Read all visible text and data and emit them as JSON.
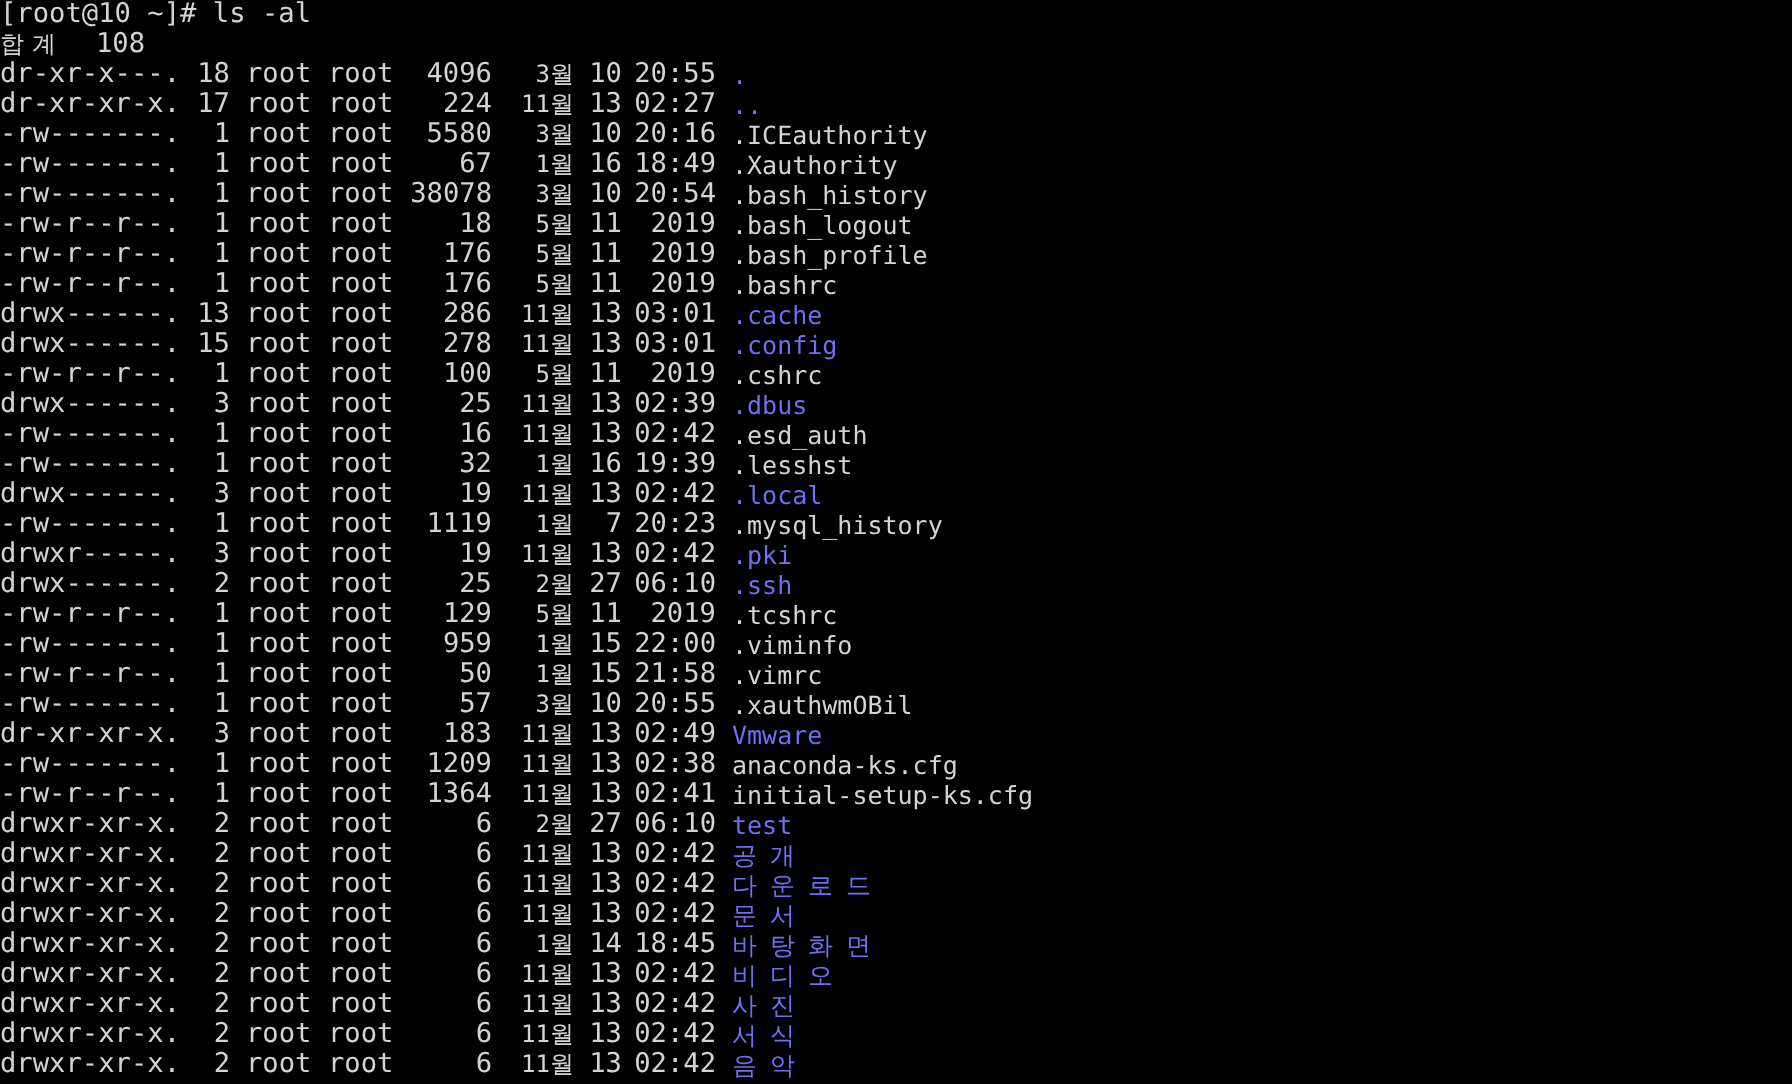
{
  "terminal": {
    "prompt": "[root@10 ~]# ls -al",
    "total_label": "합계",
    "total_value": "108",
    "entries": [
      {
        "perms": "dr-xr-x---.",
        "links": "18",
        "owner": "root",
        "group": "root",
        "size": "4096",
        "month": "3월",
        "day": "10",
        "time": "20:55",
        "name": ".",
        "kind": "dir"
      },
      {
        "perms": "dr-xr-xr-x.",
        "links": "17",
        "owner": "root",
        "group": "root",
        "size": "224",
        "month": "11월",
        "day": "13",
        "time": "02:27",
        "name": "..",
        "kind": "dir"
      },
      {
        "perms": "-rw-------.",
        "links": "1",
        "owner": "root",
        "group": "root",
        "size": "5580",
        "month": "3월",
        "day": "10",
        "time": "20:16",
        "name": ".ICEauthority",
        "kind": "file"
      },
      {
        "perms": "-rw-------.",
        "links": "1",
        "owner": "root",
        "group": "root",
        "size": "67",
        "month": "1월",
        "day": "16",
        "time": "18:49",
        "name": ".Xauthority",
        "kind": "file"
      },
      {
        "perms": "-rw-------.",
        "links": "1",
        "owner": "root",
        "group": "root",
        "size": "38078",
        "month": "3월",
        "day": "10",
        "time": "20:54",
        "name": ".bash_history",
        "kind": "file"
      },
      {
        "perms": "-rw-r--r--.",
        "links": "1",
        "owner": "root",
        "group": "root",
        "size": "18",
        "month": "5월",
        "day": "11",
        "time": "2019",
        "name": ".bash_logout",
        "kind": "file"
      },
      {
        "perms": "-rw-r--r--.",
        "links": "1",
        "owner": "root",
        "group": "root",
        "size": "176",
        "month": "5월",
        "day": "11",
        "time": "2019",
        "name": ".bash_profile",
        "kind": "file"
      },
      {
        "perms": "-rw-r--r--.",
        "links": "1",
        "owner": "root",
        "group": "root",
        "size": "176",
        "month": "5월",
        "day": "11",
        "time": "2019",
        "name": ".bashrc",
        "kind": "file"
      },
      {
        "perms": "drwx------.",
        "links": "13",
        "owner": "root",
        "group": "root",
        "size": "286",
        "month": "11월",
        "day": "13",
        "time": "03:01",
        "name": ".cache",
        "kind": "dir"
      },
      {
        "perms": "drwx------.",
        "links": "15",
        "owner": "root",
        "group": "root",
        "size": "278",
        "month": "11월",
        "day": "13",
        "time": "03:01",
        "name": ".config",
        "kind": "dir"
      },
      {
        "perms": "-rw-r--r--.",
        "links": "1",
        "owner": "root",
        "group": "root",
        "size": "100",
        "month": "5월",
        "day": "11",
        "time": "2019",
        "name": ".cshrc",
        "kind": "file"
      },
      {
        "perms": "drwx------.",
        "links": "3",
        "owner": "root",
        "group": "root",
        "size": "25",
        "month": "11월",
        "day": "13",
        "time": "02:39",
        "name": ".dbus",
        "kind": "dir"
      },
      {
        "perms": "-rw-------.",
        "links": "1",
        "owner": "root",
        "group": "root",
        "size": "16",
        "month": "11월",
        "day": "13",
        "time": "02:42",
        "name": ".esd_auth",
        "kind": "file"
      },
      {
        "perms": "-rw-------.",
        "links": "1",
        "owner": "root",
        "group": "root",
        "size": "32",
        "month": "1월",
        "day": "16",
        "time": "19:39",
        "name": ".lesshst",
        "kind": "file"
      },
      {
        "perms": "drwx------.",
        "links": "3",
        "owner": "root",
        "group": "root",
        "size": "19",
        "month": "11월",
        "day": "13",
        "time": "02:42",
        "name": ".local",
        "kind": "dir"
      },
      {
        "perms": "-rw-------.",
        "links": "1",
        "owner": "root",
        "group": "root",
        "size": "1119",
        "month": "1월",
        "day": "7",
        "time": "20:23",
        "name": ".mysql_history",
        "kind": "file"
      },
      {
        "perms": "drwxr-----.",
        "links": "3",
        "owner": "root",
        "group": "root",
        "size": "19",
        "month": "11월",
        "day": "13",
        "time": "02:42",
        "name": ".pki",
        "kind": "dir"
      },
      {
        "perms": "drwx------.",
        "links": "2",
        "owner": "root",
        "group": "root",
        "size": "25",
        "month": "2월",
        "day": "27",
        "time": "06:10",
        "name": ".ssh",
        "kind": "dir"
      },
      {
        "perms": "-rw-r--r--.",
        "links": "1",
        "owner": "root",
        "group": "root",
        "size": "129",
        "month": "5월",
        "day": "11",
        "time": "2019",
        "name": ".tcshrc",
        "kind": "file"
      },
      {
        "perms": "-rw-------.",
        "links": "1",
        "owner": "root",
        "group": "root",
        "size": "959",
        "month": "1월",
        "day": "15",
        "time": "22:00",
        "name": ".viminfo",
        "kind": "file"
      },
      {
        "perms": "-rw-r--r--.",
        "links": "1",
        "owner": "root",
        "group": "root",
        "size": "50",
        "month": "1월",
        "day": "15",
        "time": "21:58",
        "name": ".vimrc",
        "kind": "file"
      },
      {
        "perms": "-rw-------.",
        "links": "1",
        "owner": "root",
        "group": "root",
        "size": "57",
        "month": "3월",
        "day": "10",
        "time": "20:55",
        "name": ".xauthwmOBil",
        "kind": "file"
      },
      {
        "perms": "dr-xr-xr-x.",
        "links": "3",
        "owner": "root",
        "group": "root",
        "size": "183",
        "month": "11월",
        "day": "13",
        "time": "02:49",
        "name": "Vmware",
        "kind": "dir"
      },
      {
        "perms": "-rw-------.",
        "links": "1",
        "owner": "root",
        "group": "root",
        "size": "1209",
        "month": "11월",
        "day": "13",
        "time": "02:38",
        "name": "anaconda-ks.cfg",
        "kind": "file"
      },
      {
        "perms": "-rw-r--r--.",
        "links": "1",
        "owner": "root",
        "group": "root",
        "size": "1364",
        "month": "11월",
        "day": "13",
        "time": "02:41",
        "name": "initial-setup-ks.cfg",
        "kind": "file"
      },
      {
        "perms": "drwxr-xr-x.",
        "links": "2",
        "owner": "root",
        "group": "root",
        "size": "6",
        "month": "2월",
        "day": "27",
        "time": "06:10",
        "name": "test",
        "kind": "dir"
      },
      {
        "perms": "drwxr-xr-x.",
        "links": "2",
        "owner": "root",
        "group": "root",
        "size": "6",
        "month": "11월",
        "day": "13",
        "time": "02:42",
        "name": "공개",
        "kind": "dir"
      },
      {
        "perms": "drwxr-xr-x.",
        "links": "2",
        "owner": "root",
        "group": "root",
        "size": "6",
        "month": "11월",
        "day": "13",
        "time": "02:42",
        "name": "다운로드",
        "kind": "dir"
      },
      {
        "perms": "drwxr-xr-x.",
        "links": "2",
        "owner": "root",
        "group": "root",
        "size": "6",
        "month": "11월",
        "day": "13",
        "time": "02:42",
        "name": "문서",
        "kind": "dir"
      },
      {
        "perms": "drwxr-xr-x.",
        "links": "2",
        "owner": "root",
        "group": "root",
        "size": "6",
        "month": "1월",
        "day": "14",
        "time": "18:45",
        "name": "바탕화면",
        "kind": "dir"
      },
      {
        "perms": "drwxr-xr-x.",
        "links": "2",
        "owner": "root",
        "group": "root",
        "size": "6",
        "month": "11월",
        "day": "13",
        "time": "02:42",
        "name": "비디오",
        "kind": "dir"
      },
      {
        "perms": "drwxr-xr-x.",
        "links": "2",
        "owner": "root",
        "group": "root",
        "size": "6",
        "month": "11월",
        "day": "13",
        "time": "02:42",
        "name": "사진",
        "kind": "dir"
      },
      {
        "perms": "drwxr-xr-x.",
        "links": "2",
        "owner": "root",
        "group": "root",
        "size": "6",
        "month": "11월",
        "day": "13",
        "time": "02:42",
        "name": "서식",
        "kind": "dir"
      },
      {
        "perms": "drwxr-xr-x.",
        "links": "2",
        "owner": "root",
        "group": "root",
        "size": "6",
        "month": "11월",
        "day": "13",
        "time": "02:42",
        "name": "음악",
        "kind": "dir"
      }
    ]
  }
}
